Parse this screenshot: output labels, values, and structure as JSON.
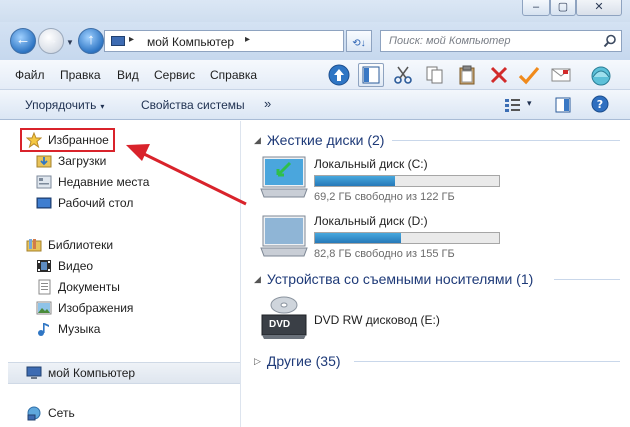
{
  "window": {
    "minimize_glyph": "–",
    "maximize_glyph": "▢",
    "close_glyph": "✕"
  },
  "address": {
    "sep1": "▸",
    "path": "мой Компьютер",
    "sep2": "▸",
    "dropdown_glyph": "▾",
    "refresh_glyph": "⟲↓"
  },
  "search": {
    "placeholder": "Поиск: мой Компьютер",
    "icon": "search-icon"
  },
  "menu": {
    "items": [
      "Файл",
      "Правка",
      "Вид",
      "Сервис",
      "Справка"
    ]
  },
  "toolbar_icons": [
    "up-arrow-icon",
    "view-pane-icon",
    "cut-icon",
    "copy-icon",
    "paste-icon",
    "delete-icon",
    "checkmark-icon",
    "mail-icon",
    "shell-icon"
  ],
  "command_bar": {
    "organize": "Упорядочить",
    "caret": "▾",
    "system_properties": "Свойства системы",
    "more": "»"
  },
  "nav_pane": {
    "favorites": "Избранное",
    "downloads": "Загрузки",
    "recent": "Недавние места",
    "desktop": "Рабочий стол",
    "libraries": "Библиотеки",
    "video": "Видео",
    "documents": "Документы",
    "images": "Изображения",
    "music": "Музыка",
    "computer": "мой Компьютер",
    "network": "Сеть"
  },
  "content": {
    "hard_drives_header": "Жесткие диски (2)",
    "drive_c": {
      "name": "Локальный диск (C:)",
      "free": "69,2 ГБ свободно из 122 ГБ",
      "used_fraction": 0.433
    },
    "drive_d": {
      "name": "Локальный диск (D:)",
      "free": "82,8 ГБ свободно из 155 ГБ",
      "used_fraction": 0.466
    },
    "removable_header": "Устройства со съемными носителями (1)",
    "dvd": {
      "name": "DVD RW дисковод (E:)",
      "label": "DVD"
    },
    "other_header": "Другие (35)",
    "tri_open": "◢",
    "tri_closed": "▷"
  },
  "colors": {
    "annotation": "#d9232b",
    "link_blue": "#1e3a78",
    "bar_fill": "#2f86c8"
  }
}
